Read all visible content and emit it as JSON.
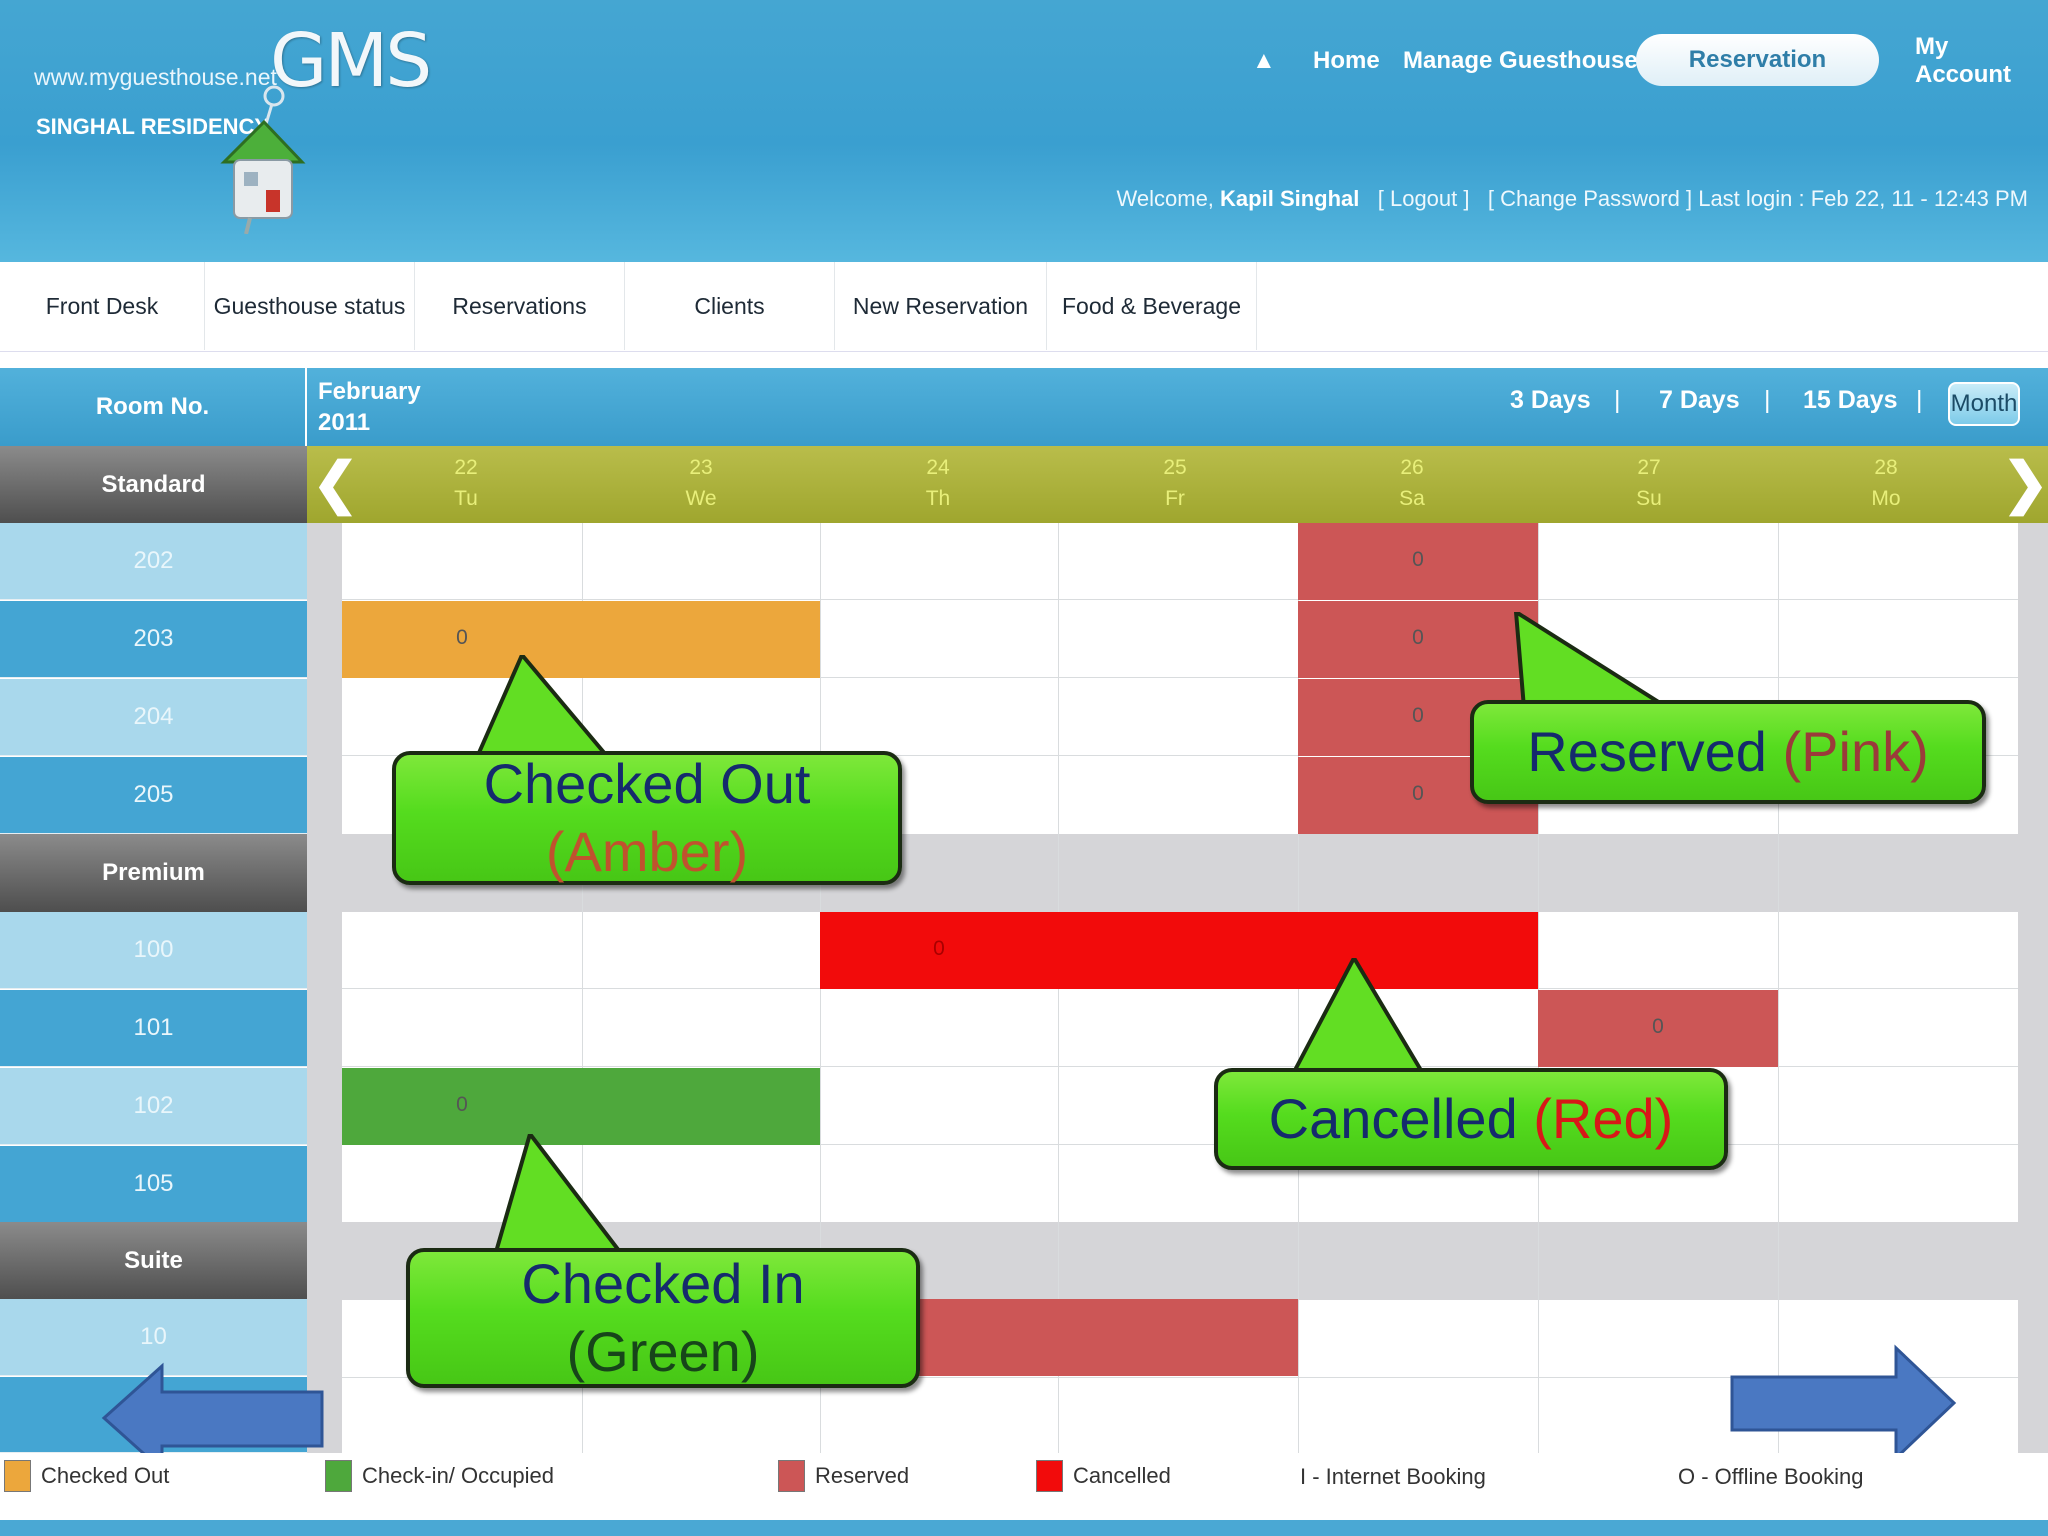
{
  "header": {
    "site_url": "www.myguesthouse.net",
    "logo_text": "GMS",
    "brand_name": "SINGHAL RESIDENCY",
    "nav": {
      "home": "Home",
      "manage": "Manage Guesthouse",
      "reservation": "Reservation",
      "my_account": "My Account"
    },
    "welcome_prefix": "Welcome,",
    "user_name": "Kapil Singhal",
    "logout": "[ Logout ]",
    "change_password": "[ Change Password ]",
    "last_login": "Last login : Feb 22, 11 - 12:43 PM"
  },
  "menu": [
    "Front Desk",
    "Guesthouse status",
    "Reservations",
    "Clients",
    "New Reservation",
    "Food & Beverage"
  ],
  "calendar": {
    "room_no_label": "Room No.",
    "month": "February",
    "year": "2011",
    "ranges": [
      "3 Days",
      "7 Days",
      "15 Days"
    ],
    "separator": "|",
    "month_button": "Month",
    "prev_icon": "chevron-left-icon",
    "next_icon": "chevron-right-icon",
    "prev_glyph": "❮",
    "next_glyph": "❯",
    "days": [
      {
        "date": "22",
        "dow": "Tu"
      },
      {
        "date": "23",
        "dow": "We"
      },
      {
        "date": "24",
        "dow": "Th"
      },
      {
        "date": "25",
        "dow": "Fr"
      },
      {
        "date": "26",
        "dow": "Sa"
      },
      {
        "date": "27",
        "dow": "Su"
      },
      {
        "date": "28",
        "dow": "Mo"
      }
    ],
    "groups": {
      "standard": "Standard",
      "premium": "Premium",
      "suite": "Suite"
    },
    "rooms": [
      "202",
      "203",
      "204",
      "205",
      "100",
      "101",
      "102",
      "105",
      "10"
    ],
    "booking_mark": "0"
  },
  "callouts": {
    "checked_out": {
      "title": "Checked Out",
      "color": "(Amber)"
    },
    "reserved": {
      "title": "Reserved",
      "color": "(Pink)"
    },
    "cancelled": {
      "title": "Cancelled",
      "color": "(Red)"
    },
    "checked_in": {
      "title": "Checked In",
      "color": "(Green)"
    }
  },
  "legend": {
    "checked_out": "Checked Out",
    "checkin": "Check-in/ Occupied",
    "reserved": "Reserved",
    "cancelled": "Cancelled",
    "internet": "I - Internet Booking",
    "offline": "O - Offline Booking"
  },
  "colors": {
    "amber": "#eca73c",
    "green": "#4ea83c",
    "pink": "#cc5656",
    "red": "#f20b0b",
    "header_blue": "#3a9fd0",
    "day_bar": "#a4ab33"
  }
}
